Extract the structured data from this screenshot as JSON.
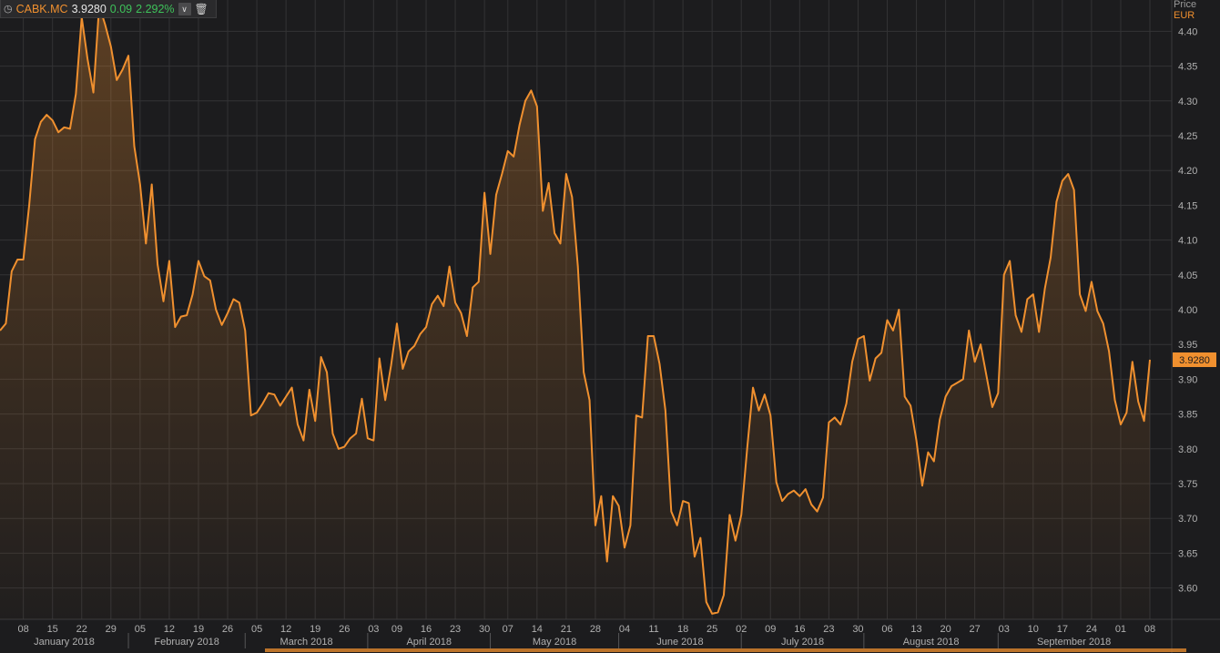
{
  "header": {
    "clock_icon": "clock-icon",
    "symbol": "CABK.MC",
    "price": "3.9280",
    "change": "0.09",
    "change_pct": "2.292%",
    "positive_color": "#3ec25a",
    "dropdown_icon": "chevron-down-icon",
    "delete_icon": "trash-icon"
  },
  "y_title": {
    "label": "Price",
    "currency": "EUR"
  },
  "chart_data": {
    "type": "area",
    "series": [
      {
        "color": "#f0902f",
        "values": [
          3.97,
          3.98,
          4.055,
          4.072,
          4.072,
          4.15,
          4.245,
          4.27,
          4.28,
          4.272,
          4.255,
          4.262,
          4.26,
          4.31,
          4.42,
          4.36,
          4.312,
          4.437,
          4.41,
          4.378,
          4.33,
          4.345,
          4.365,
          4.235,
          4.18,
          4.095,
          4.18,
          4.065,
          4.012,
          4.07,
          3.975,
          3.99,
          3.992,
          4.022,
          4.07,
          4.048,
          4.042,
          4.0,
          3.978,
          3.995,
          4.015,
          4.01,
          3.97,
          3.848,
          3.852,
          3.865,
          3.88,
          3.878,
          3.862,
          3.875,
          3.888,
          3.835,
          3.812,
          3.885,
          3.84,
          3.932,
          3.91,
          3.822,
          3.8,
          3.803,
          3.815,
          3.822,
          3.872,
          3.815,
          3.812,
          3.93,
          3.87,
          3.92,
          3.98,
          3.915,
          3.94,
          3.948,
          3.965,
          3.975,
          4.008,
          4.02,
          4.005,
          4.062,
          4.01,
          3.995,
          3.962,
          4.032,
          4.04,
          4.168,
          4.08,
          4.165,
          4.195,
          4.228,
          4.22,
          4.265,
          4.3,
          4.315,
          4.292,
          4.142,
          4.182,
          4.11,
          4.095,
          4.195,
          4.162,
          4.062,
          3.91,
          3.87,
          3.69,
          3.732,
          3.638,
          3.732,
          3.718,
          3.658,
          3.69,
          3.848,
          3.845,
          3.962,
          3.962,
          3.922,
          3.855,
          3.71,
          3.69,
          3.725,
          3.722,
          3.645,
          3.672,
          3.58,
          3.563,
          3.565,
          3.59,
          3.705,
          3.668,
          3.705,
          3.8,
          3.888,
          3.855,
          3.878,
          3.848,
          3.752,
          3.725,
          3.735,
          3.74,
          3.732,
          3.742,
          3.72,
          3.71,
          3.73,
          3.838,
          3.845,
          3.835,
          3.865,
          3.925,
          3.958,
          3.962,
          3.898,
          3.93,
          3.938,
          3.985,
          3.97,
          4.0,
          3.875,
          3.862,
          3.812,
          3.747,
          3.795,
          3.782,
          3.842,
          3.875,
          3.89,
          3.895,
          3.9,
          3.97,
          3.925,
          3.95,
          3.905,
          3.86,
          3.88,
          4.05,
          4.07,
          3.992,
          3.968,
          4.015,
          4.022,
          3.968,
          4.03,
          4.075,
          4.155,
          4.185,
          4.195,
          4.172,
          4.022,
          3.998,
          4.04,
          3.998,
          3.98,
          3.94,
          3.87,
          3.835,
          3.852,
          3.925,
          3.868,
          3.84,
          3.928
        ]
      }
    ],
    "y_axis": {
      "ticks": [
        "3.60",
        "3.65",
        "3.70",
        "3.75",
        "3.80",
        "3.85",
        "3.90",
        "3.95",
        "4.00",
        "4.05",
        "4.10",
        "4.15",
        "4.20",
        "4.25",
        "4.30",
        "4.35",
        "4.40"
      ],
      "range": [
        3.555,
        4.445
      ]
    },
    "x_axis": {
      "day_ticks": [
        {
          "i": 4,
          "label": "08"
        },
        {
          "i": 9,
          "label": "15"
        },
        {
          "i": 14,
          "label": "22"
        },
        {
          "i": 19,
          "label": "29"
        },
        {
          "i": 24,
          "label": "05"
        },
        {
          "i": 29,
          "label": "12"
        },
        {
          "i": 34,
          "label": "19"
        },
        {
          "i": 39,
          "label": "26"
        },
        {
          "i": 44,
          "label": "05"
        },
        {
          "i": 49,
          "label": "12"
        },
        {
          "i": 54,
          "label": "19"
        },
        {
          "i": 59,
          "label": "26"
        },
        {
          "i": 64,
          "label": "03"
        },
        {
          "i": 68,
          "label": "09"
        },
        {
          "i": 73,
          "label": "16"
        },
        {
          "i": 78,
          "label": "23"
        },
        {
          "i": 83,
          "label": "30"
        },
        {
          "i": 87,
          "label": "07"
        },
        {
          "i": 92,
          "label": "14"
        },
        {
          "i": 97,
          "label": "21"
        },
        {
          "i": 102,
          "label": "28"
        },
        {
          "i": 107,
          "label": "04"
        },
        {
          "i": 112,
          "label": "11"
        },
        {
          "i": 117,
          "label": "18"
        },
        {
          "i": 122,
          "label": "25"
        },
        {
          "i": 127,
          "label": "02"
        },
        {
          "i": 132,
          "label": "09"
        },
        {
          "i": 137,
          "label": "16"
        },
        {
          "i": 142,
          "label": "23"
        },
        {
          "i": 147,
          "label": "30"
        },
        {
          "i": 152,
          "label": "06"
        },
        {
          "i": 157,
          "label": "13"
        },
        {
          "i": 162,
          "label": "20"
        },
        {
          "i": 167,
          "label": "27"
        },
        {
          "i": 172,
          "label": "03"
        },
        {
          "i": 177,
          "label": "10"
        },
        {
          "i": 182,
          "label": "17"
        },
        {
          "i": 187,
          "label": "24"
        },
        {
          "i": 192,
          "label": "01"
        },
        {
          "i": 197,
          "label": "08"
        }
      ],
      "months": [
        {
          "label": "January 2018",
          "start": 0,
          "end": 22
        },
        {
          "label": "February 2018",
          "start": 22,
          "end": 42
        },
        {
          "label": "March 2018",
          "start": 42,
          "end": 63
        },
        {
          "label": "April 2018",
          "start": 63,
          "end": 84
        },
        {
          "label": "May 2018",
          "start": 84,
          "end": 106
        },
        {
          "label": "June 2018",
          "start": 106,
          "end": 127
        },
        {
          "label": "July 2018",
          "start": 127,
          "end": 148
        },
        {
          "label": "August 2018",
          "start": 148,
          "end": 171
        },
        {
          "label": "September 2018",
          "start": 171,
          "end": 197
        }
      ]
    },
    "last_value_label": "3.9280",
    "grid": true
  }
}
